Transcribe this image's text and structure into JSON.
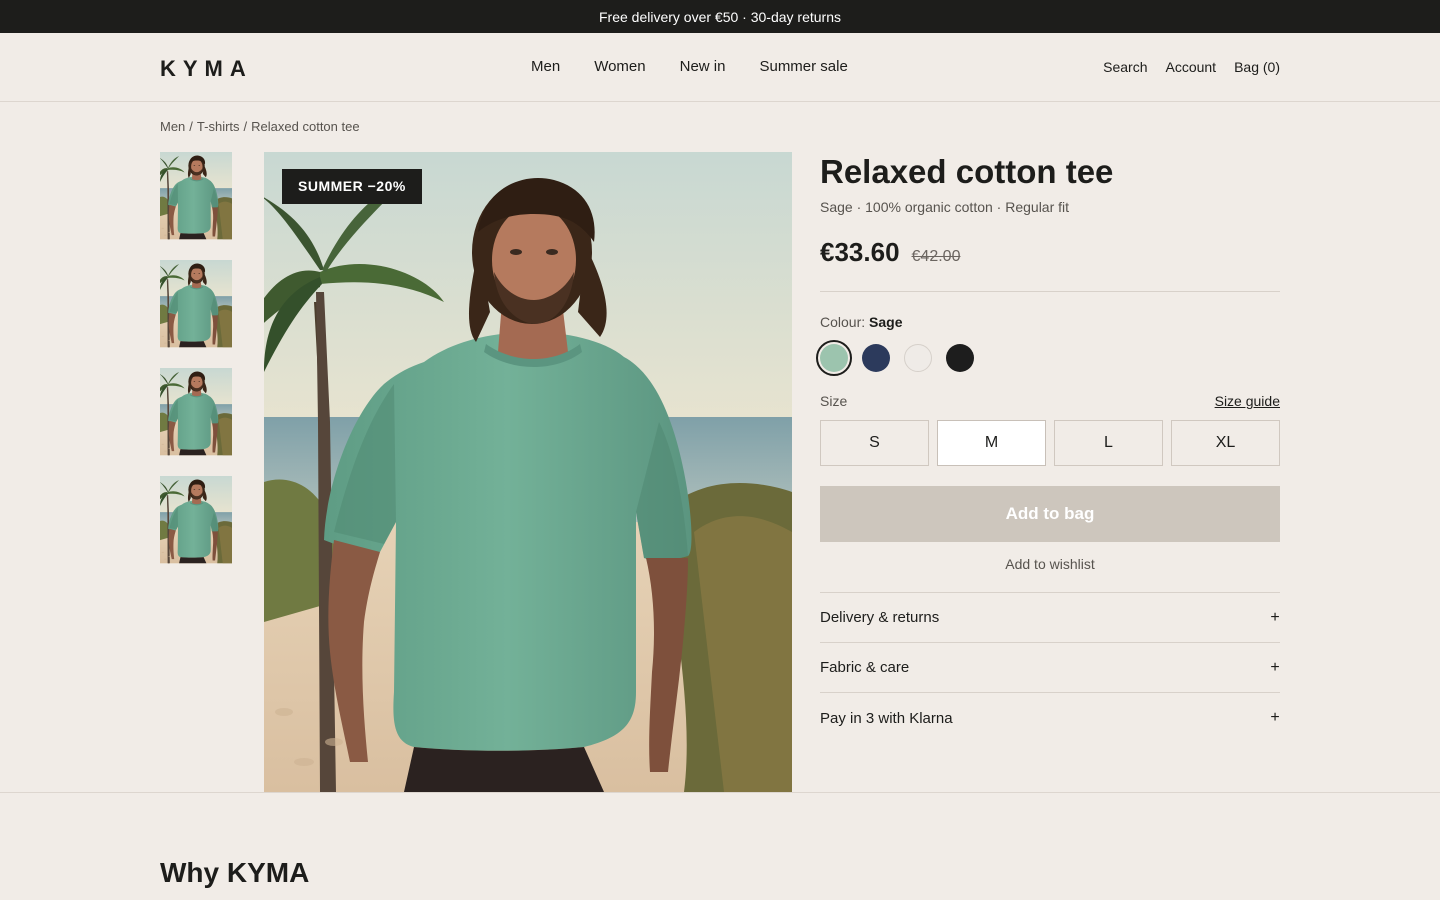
{
  "announcement": "Free delivery over €50 · 30-day returns",
  "header": {
    "logo": "KYMA",
    "nav": [
      "Men",
      "Women",
      "New in",
      "Summer sale"
    ],
    "utilities": {
      "search": "Search",
      "account": "Account",
      "bag": "Bag (0)"
    }
  },
  "breadcrumb": [
    "Men",
    "/",
    "T-shirts",
    "/",
    "Relaxed cotton tee"
  ],
  "gallery": {
    "badge": "SUMMER −20%",
    "thumbnails_count_label": ""
  },
  "product": {
    "title": "Relaxed cotton tee",
    "subtitle": "Sage · 100% organic cotton · Regular fit",
    "price": "€33.60",
    "price_old": "€42.00",
    "colour_label": "Colour:",
    "colour_selected": "Sage",
    "colours": [
      "#9cc4ae",
      "#2c3a5c",
      "#efebe7",
      "#1d1d1d"
    ],
    "size_label": "Size",
    "size_guide": "Size guide",
    "sizes": [
      "S",
      "M",
      "L",
      "XL"
    ],
    "selected_size": "M",
    "add_to_bag": "Add to bag",
    "wishlist": "Add to wishlist"
  },
  "accordion": [
    "Delivery & returns",
    "Fabric & care",
    "Pay in 3 with Klarna"
  ],
  "accordion_icon": "+",
  "section_title": "Why KYMA"
}
